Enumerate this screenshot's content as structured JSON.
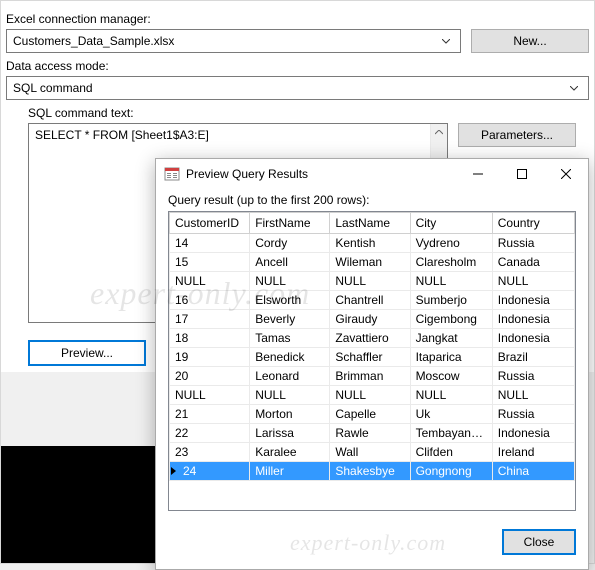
{
  "labels": {
    "excel_conn": "Excel connection manager:",
    "data_access": "Data access mode:",
    "sql_text": "SQL command text:"
  },
  "fields": {
    "excel_conn_value": "Customers_Data_Sample.xlsx",
    "data_access_value": "SQL command",
    "sql_text_value": "SELECT * FROM [Sheet1$A3:E]"
  },
  "buttons": {
    "new": "New...",
    "parameters": "Parameters...",
    "preview": "Preview...",
    "close": "Close"
  },
  "dialog": {
    "title": "Preview Query Results",
    "subtitle": "Query result (up to the first 200 rows):",
    "headers": [
      "CustomerID",
      "FirstName",
      "LastName",
      "City",
      "Country"
    ],
    "rows": [
      [
        "14",
        "Cordy",
        "Kentish",
        "Vydreno",
        "Russia"
      ],
      [
        "15",
        "Ancell",
        "Wileman",
        "Claresholm",
        "Canada"
      ],
      [
        "NULL",
        "NULL",
        "NULL",
        "NULL",
        "NULL"
      ],
      [
        "16",
        "Elsworth",
        "Chantrell",
        "Sumberjo",
        "Indonesia"
      ],
      [
        "17",
        "Beverly",
        "Giraudy",
        "Cigembong",
        "Indonesia"
      ],
      [
        "18",
        "Tamas",
        "Zavattiero",
        "Jangkat",
        "Indonesia"
      ],
      [
        "19",
        "Benedick",
        "Schaffler",
        "Itaparica",
        "Brazil"
      ],
      [
        "20",
        "Leonard",
        "Brimman",
        "Moscow",
        "Russia"
      ],
      [
        "NULL",
        "NULL",
        "NULL",
        "NULL",
        "NULL"
      ],
      [
        "21",
        "Morton",
        "Capelle",
        "Uk",
        "Russia"
      ],
      [
        "22",
        "Larissa",
        "Rawle",
        "Tembayanga...",
        "Indonesia"
      ],
      [
        "23",
        "Karalee",
        "Wall",
        "Clifden",
        "Ireland"
      ],
      [
        "24",
        "Miller",
        "Shakesbye",
        "Gongnong",
        "China"
      ]
    ],
    "selected_row": 12
  },
  "watermark": "expert-only.com"
}
